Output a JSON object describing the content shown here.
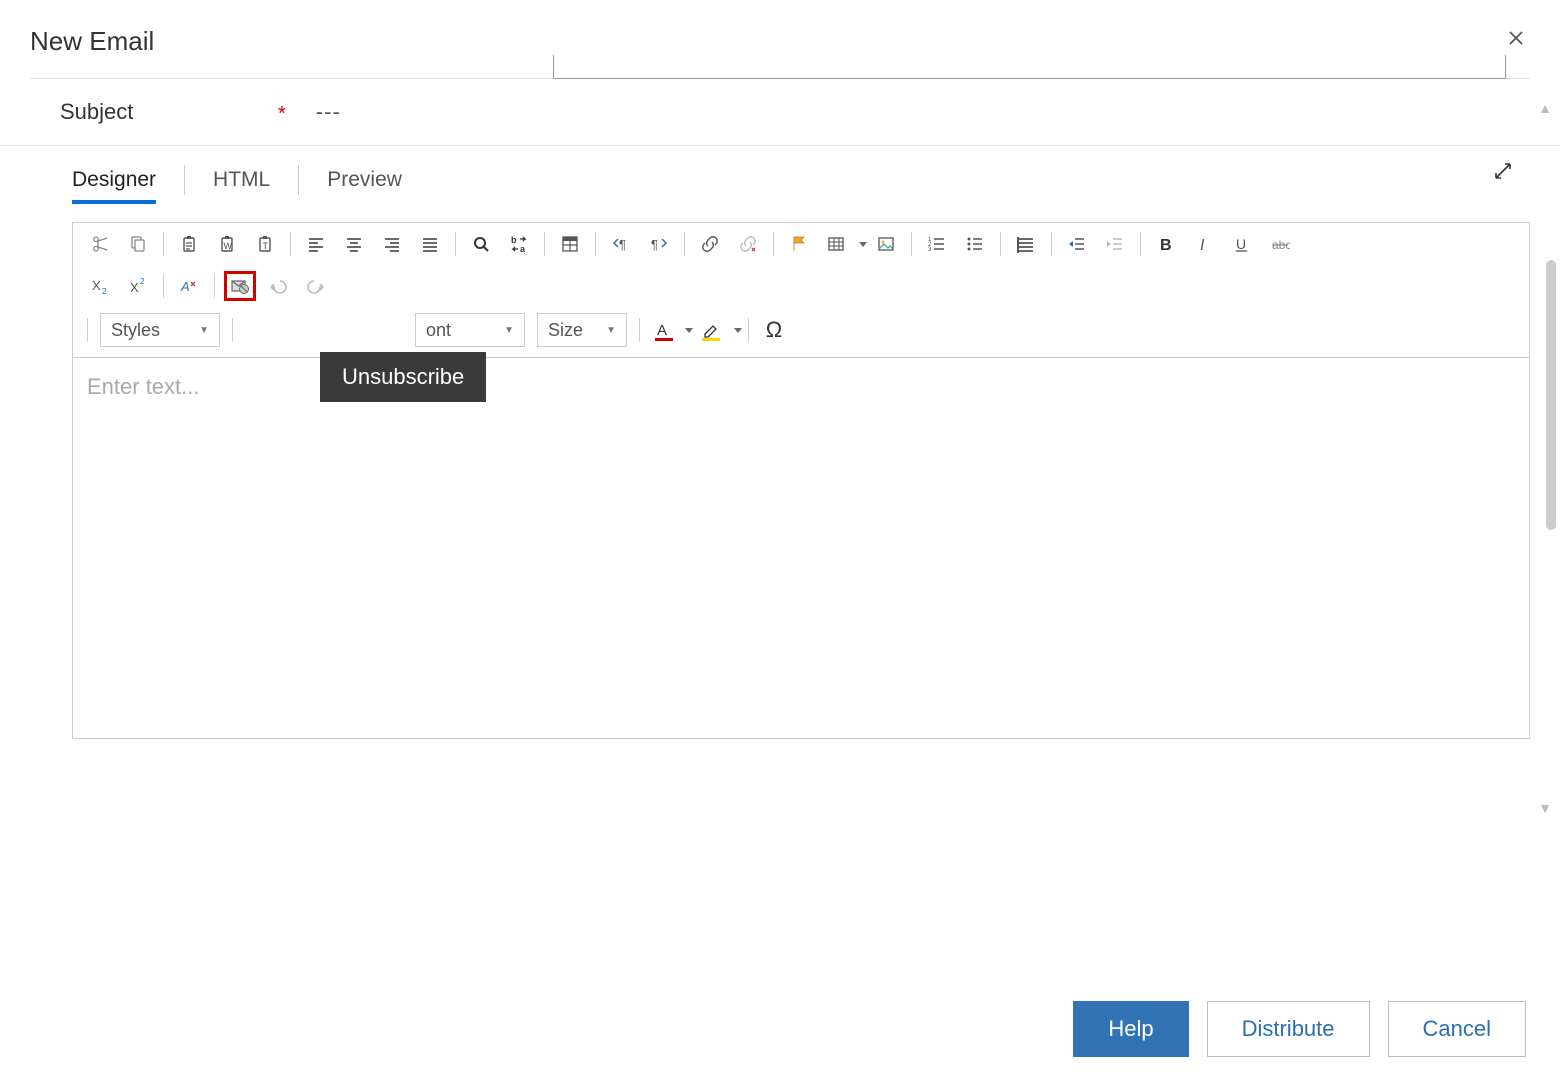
{
  "header": {
    "title": "New Email"
  },
  "subject": {
    "label": "Subject",
    "required_mark": "*",
    "value": "---"
  },
  "tabs": [
    {
      "id": "designer",
      "label": "Designer",
      "active": true
    },
    {
      "id": "html",
      "label": "HTML",
      "active": false
    },
    {
      "id": "preview",
      "label": "Preview",
      "active": false
    }
  ],
  "tooltip": {
    "text": "Unsubscribe"
  },
  "dropdowns": {
    "styles": {
      "label": "Styles"
    },
    "font": {
      "visible_stub": "ont"
    },
    "size": {
      "label": "Size"
    }
  },
  "editor": {
    "placeholder": "Enter text..."
  },
  "footer": {
    "help": "Help",
    "distribute": "Distribute",
    "cancel": "Cancel"
  },
  "toolbar_row1": [
    {
      "name": "cut-icon"
    },
    {
      "name": "copy-icon"
    },
    {
      "sep": true
    },
    {
      "name": "paste-icon"
    },
    {
      "name": "paste-from-word-icon"
    },
    {
      "name": "paste-plain-text-icon"
    },
    {
      "sep": true
    },
    {
      "name": "align-left-icon"
    },
    {
      "name": "align-center-icon"
    },
    {
      "name": "align-right-icon"
    },
    {
      "name": "align-justify-icon"
    },
    {
      "sep": true
    },
    {
      "name": "find-icon"
    },
    {
      "name": "replace-icon"
    },
    {
      "sep": true
    },
    {
      "name": "templates-icon"
    },
    {
      "sep": true
    },
    {
      "name": "ltr-icon"
    },
    {
      "name": "rtl-icon"
    },
    {
      "sep": true
    },
    {
      "name": "link-icon"
    },
    {
      "name": "unlink-icon",
      "disabled": true
    },
    {
      "sep": true
    },
    {
      "name": "anchor-flag-icon"
    },
    {
      "name": "table-icon",
      "caret": true
    },
    {
      "name": "image-icon"
    },
    {
      "sep": true
    },
    {
      "name": "numbered-list-icon"
    },
    {
      "name": "bullet-list-icon"
    },
    {
      "sep": true
    },
    {
      "name": "blockquote-icon"
    },
    {
      "sep": true
    },
    {
      "name": "indent-icon"
    },
    {
      "name": "outdent-icon",
      "disabled": true
    },
    {
      "sep": true
    },
    {
      "name": "bold-icon"
    },
    {
      "name": "italic-icon"
    },
    {
      "name": "underline-icon"
    },
    {
      "name": "strikethrough-icon"
    }
  ],
  "toolbar_row2": [
    {
      "name": "subscript-icon"
    },
    {
      "name": "superscript-icon"
    },
    {
      "sep": true
    },
    {
      "name": "remove-format-icon"
    },
    {
      "sep": true
    },
    {
      "name": "unsubscribe-icon",
      "highlight": true
    },
    {
      "name": "undo-icon",
      "disabled": true
    },
    {
      "name": "redo-icon",
      "disabled": true
    }
  ]
}
